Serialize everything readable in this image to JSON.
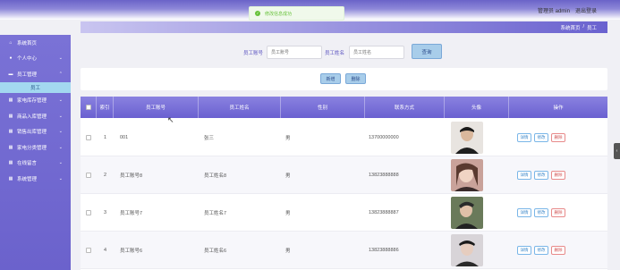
{
  "topbar": {
    "admin_label": "管理员 admin",
    "logout_label": "退出登录"
  },
  "toast": {
    "message": "修改信息成功"
  },
  "sidebar": {
    "items": [
      {
        "label": "系统首页",
        "icon": "home-icon",
        "has_children": false
      },
      {
        "label": "个人中心",
        "icon": "user-icon",
        "has_children": true
      },
      {
        "label": "员工管理",
        "icon": "employee-icon",
        "has_children": true,
        "expanded": true,
        "sub": [
          "员工"
        ]
      },
      {
        "label": "家电库存管理",
        "icon": "grid-icon",
        "has_children": true
      },
      {
        "label": "商品入库管理",
        "icon": "grid-icon",
        "has_children": true
      },
      {
        "label": "销售出库管理",
        "icon": "grid-icon",
        "has_children": true
      },
      {
        "label": "家电分类管理",
        "icon": "grid-icon",
        "has_children": true
      },
      {
        "label": "在线留言",
        "icon": "grid-icon",
        "has_children": true
      },
      {
        "label": "系统管理",
        "icon": "grid-icon",
        "has_children": true
      }
    ]
  },
  "breadcrumb": {
    "home": "系统首页",
    "sep": "/",
    "current": "员工"
  },
  "search": {
    "account_label": "员工账号",
    "account_placeholder": "员工账号",
    "name_label": "员工姓名",
    "name_placeholder": "员工姓名",
    "button": "查询"
  },
  "toolbar": {
    "add_label": "新增",
    "delete_label": "删除"
  },
  "table": {
    "headers": [
      "索引",
      "员工账号",
      "员工姓名",
      "性别",
      "联系方式",
      "头像",
      "操作"
    ],
    "rows": [
      {
        "index": "1",
        "account": "001",
        "name": "张三",
        "gender": "男",
        "phone": "13700000000"
      },
      {
        "index": "2",
        "account": "员工账号8",
        "name": "员工姓名8",
        "gender": "男",
        "phone": "13823888888"
      },
      {
        "index": "3",
        "account": "员工账号7",
        "name": "员工姓名7",
        "gender": "男",
        "phone": "13823888887"
      },
      {
        "index": "4",
        "account": "员工账号6",
        "name": "员工姓名6",
        "gender": "男",
        "phone": "13823888886"
      }
    ],
    "actions": {
      "detail": "详情",
      "edit": "修改",
      "delete": "删除"
    }
  },
  "colors": {
    "primary": "#6b62cc",
    "header_gradient_start": "#8a82e0",
    "button_bg": "#a8cdea",
    "danger": "#d05050"
  }
}
